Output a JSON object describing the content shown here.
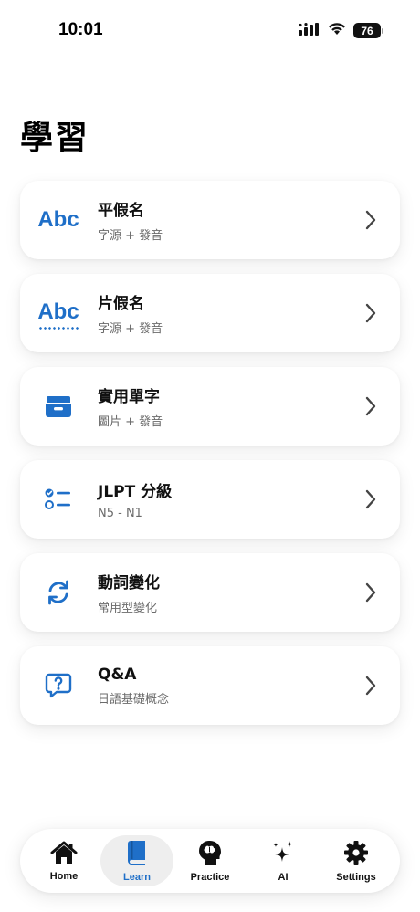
{
  "status_bar": {
    "time": "10:01",
    "battery": "76",
    "icons": [
      "cellular-signal-icon",
      "wifi-icon",
      "battery-icon"
    ]
  },
  "page": {
    "title": "學習"
  },
  "colors": {
    "accent": "#1f6fc8",
    "text": "#111111",
    "subtext": "#6b6b6b"
  },
  "items": [
    {
      "title": "平假名",
      "subtitle": "字源 + 發音",
      "icon": "abc-text-icon",
      "icon_text": "Abc"
    },
    {
      "title": "片假名",
      "subtitle": "字源 + 發音",
      "icon": "abc-dotted-text-icon",
      "icon_text": "Abc"
    },
    {
      "title": "實用單字",
      "subtitle": "圖片 + 發音",
      "icon": "tray-icon"
    },
    {
      "title": "JLPT 分級",
      "subtitle": "N5 - N1",
      "icon": "checklist-icon"
    },
    {
      "title": "動詞變化",
      "subtitle": "常用型變化",
      "icon": "refresh-arrows-icon"
    },
    {
      "title": "Q&A",
      "subtitle": "日語基礎概念",
      "icon": "question-bubble-icon"
    }
  ],
  "tab_bar": {
    "active": "Learn",
    "tabs": [
      {
        "label": "Home",
        "icon": "house-icon"
      },
      {
        "label": "Learn",
        "icon": "book-icon"
      },
      {
        "label": "Practice",
        "icon": "brain-head-icon"
      },
      {
        "label": "AI",
        "icon": "sparkles-icon"
      },
      {
        "label": "Settings",
        "icon": "gear-icon"
      }
    ]
  }
}
